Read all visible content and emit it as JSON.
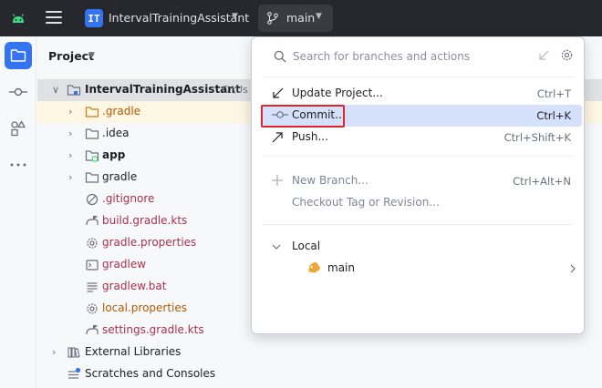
{
  "header": {
    "project_badge": "IT",
    "project_name": "IntervalTrainingAssistant",
    "branch": "main"
  },
  "project_panel": {
    "title": "Project",
    "root": {
      "label": "IntervalTrainingAssistant",
      "path": "C:\\Us"
    },
    "items": [
      {
        "label": ".gradle",
        "type": "folder"
      },
      {
        "label": ".idea",
        "type": "folder"
      },
      {
        "label": "app",
        "type": "module"
      },
      {
        "label": "gradle",
        "type": "folder"
      },
      {
        "label": ".gitignore",
        "type": "file"
      },
      {
        "label": "build.gradle.kts",
        "type": "file"
      },
      {
        "label": "gradle.properties",
        "type": "file"
      },
      {
        "label": "gradlew",
        "type": "file"
      },
      {
        "label": "gradlew.bat",
        "type": "file"
      },
      {
        "label": "local.properties",
        "type": "file"
      },
      {
        "label": "settings.gradle.kts",
        "type": "file"
      }
    ],
    "external_libraries": "External Libraries",
    "scratches": "Scratches and Consoles"
  },
  "branch_popup": {
    "search_placeholder": "Search for branches and actions",
    "actions": [
      {
        "label": "Update Project...",
        "shortcut": "Ctrl+T"
      },
      {
        "label": "Commit...",
        "shortcut": "Ctrl+K"
      },
      {
        "label": "Push...",
        "shortcut": "Ctrl+Shift+K"
      }
    ],
    "branch_actions": [
      {
        "label": "New Branch...",
        "shortcut": "Ctrl+Alt+N"
      },
      {
        "label": "Checkout Tag or Revision...",
        "shortcut": ""
      }
    ],
    "local_section": "Local",
    "local_branches": [
      {
        "name": "main"
      }
    ]
  },
  "colors": {
    "accent": "#3574f0",
    "highlight_box": "#e0242b",
    "tag_orange": "#f0a732"
  }
}
